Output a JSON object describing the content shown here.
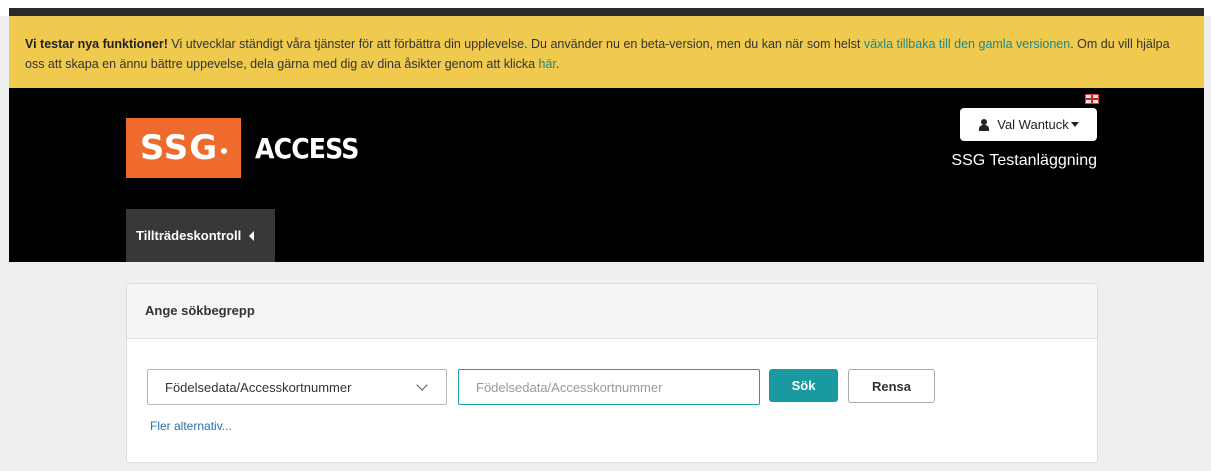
{
  "beta_banner": {
    "lead": "Vi testar nya funktioner!",
    "text1": " Vi utvecklar ständigt våra tjänster för att förbättra din upplevelse. Du använder nu en beta-version, men du kan när som helst ",
    "link_back": "växla tillbaka till den gamla versionen",
    "text2": ". Om du vill hjälpa oss att skapa en ännu bättre uppevelse, dela gärna med dig av dina åsikter genom att klicka ",
    "link_here": "här",
    "text3": "."
  },
  "header": {
    "logo_box": "SSG",
    "logo_text": "ACCESS",
    "user_name": "Val Wantuck",
    "org_name": "SSG Testanläggning",
    "nav_tab": "Tillträdeskontroll"
  },
  "search_panel": {
    "title": "Ange sökbegrepp",
    "select_value": "Födelsedata/Accesskortnummer",
    "input_placeholder": "Födelsedata/Accesskortnummer",
    "input_value": "",
    "search_button": "Sök",
    "clear_button": "Rensa",
    "more_options": "Fler alternativ..."
  },
  "colors": {
    "banner": "#f0c94f",
    "logo_orange": "#ee6a2d",
    "accent_teal": "#1a9aa0"
  },
  "icons": [
    "flag-icon",
    "user-icon",
    "caret-down-icon",
    "caret-left-icon",
    "chevron-down-icon"
  ]
}
